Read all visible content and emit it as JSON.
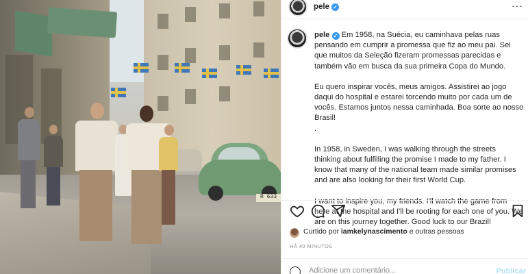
{
  "post": {
    "username": "pele",
    "verified_mark": "✓",
    "more_icon": "···",
    "caption": {
      "username": "pele",
      "para1": "Em 1958, na Suécia, eu caminhava pelas ruas pensando em cumprir a promessa que fiz ao meu pai. Sei que muitos da Seleção fizeram promessas parecidas e também vão em busca da sua primeira Copa do Mundo.",
      "para2": "Eu quero inspirar vocês, meus amigos. Assistirei ao jogo daqui do hospital e estarei torcendo muito por cada um de vocês. Estamos juntos nessa caminhada. Boa sorte ao nosso Brasil!\n.",
      "para3": "In 1958, in Sweden, I was walking through the streets thinking about fulfilling the promise I made to my father. I know that many of the national team made similar promises and are also looking for their first World Cup.",
      "para4": "I want to inspire you, my friends. I'll watch the game from here at the hospital and I'll be rooting for each one of you. We are on this journey together. Good luck to our Brazil!"
    },
    "likes": {
      "prefix": "Curtido por",
      "user": "iamkelynascimento",
      "suffix": "e outras pessoas"
    },
    "timestamp": "HÁ 40 MINUTOS",
    "comment_placeholder": "Adicione um comentário...",
    "publish_label": "Publicar"
  },
  "photo": {
    "plate_text": "R 633"
  },
  "icons": {
    "like": "heart-icon",
    "comment": "comment-icon",
    "share": "paper-plane-icon",
    "save": "bookmark-icon",
    "emoji": "smiley-icon"
  },
  "colors": {
    "verified": "#3897f0",
    "publish_disabled": "#b2dffc",
    "secondary_text": "#8e8e8e"
  }
}
